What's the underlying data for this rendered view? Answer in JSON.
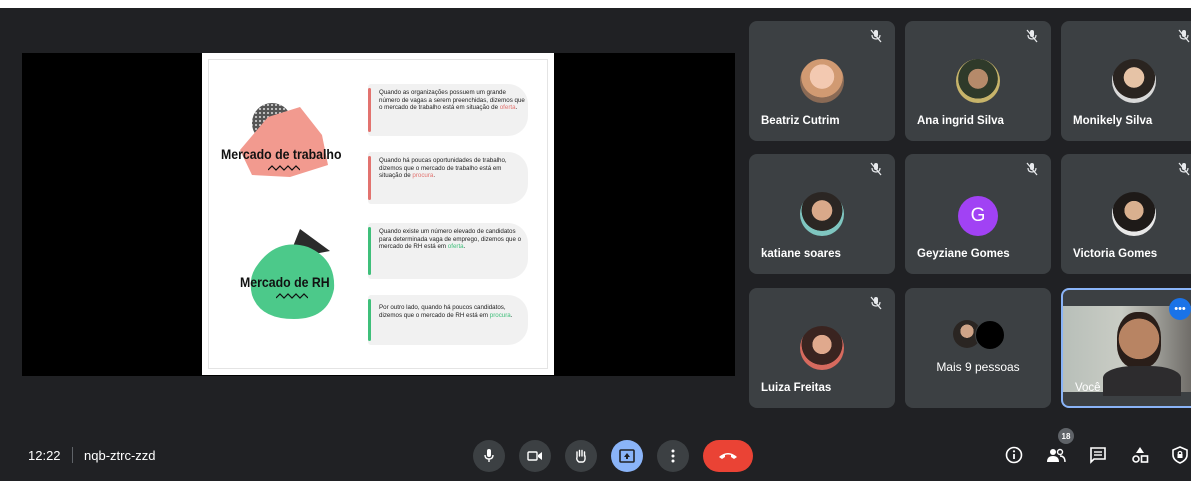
{
  "slide": {
    "title_top": "Mercado de trabalho",
    "title_bottom": "Mercado de RH",
    "cards": [
      {
        "text": "Quando as organizações possuem um grande número de vagas a serem preenchidas, dizemos que o mercado de trabalho está em situação de ",
        "highlight": "oferta",
        "end": ".",
        "accent": "#e2736f"
      },
      {
        "text": "Quando há poucas oportunidades de trabalho, dizemos que o mercado de trabalho está em situação de ",
        "highlight": "procura",
        "end": ".",
        "accent": "#e2736f"
      },
      {
        "text": "Quando existe um número elevado de candidatos para determinada vaga de emprego, dizemos que o mercado de RH está em ",
        "highlight": "oferta",
        "end": ".",
        "accent": "#3fbf7a"
      },
      {
        "text": "Por outro lado, quando há poucos candidatos, dizemos que o mercado de RH está em ",
        "highlight": "procura",
        "end": ".",
        "accent": "#3fbf7a"
      }
    ]
  },
  "participants": [
    {
      "name": "Beatriz Cutrim"
    },
    {
      "name": "Ana ingrid Silva"
    },
    {
      "name": "Monikely Silva"
    },
    {
      "name": "katiane soares"
    },
    {
      "name": "Geyziane Gomes",
      "initial": "G"
    },
    {
      "name": "Victoria Gomes"
    },
    {
      "name": "Luiza Freitas"
    },
    {
      "name": "Mais 9 pessoas"
    },
    {
      "name": "Você"
    }
  ],
  "bottom_bar": {
    "time": "12:22",
    "meeting_code": "nqb-ztrc-zzd",
    "people_count": "18"
  },
  "colors": {
    "background": "#202124",
    "tile": "#3c4043",
    "present_active": "#8ab4f8",
    "end_call": "#ea4335"
  }
}
